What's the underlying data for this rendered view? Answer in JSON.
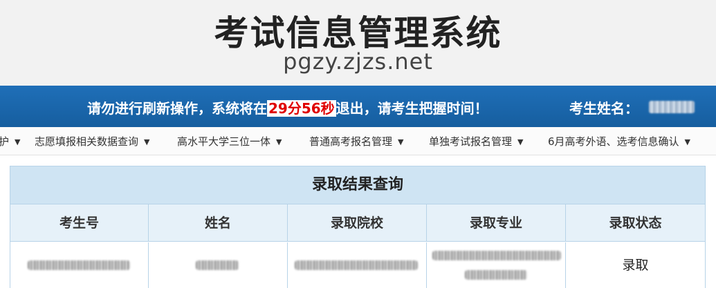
{
  "header": {
    "title": "考试信息管理系统",
    "url": "pgzy.zjzs.net"
  },
  "notice": {
    "prefix": "请勿进行刷新操作，系统将在",
    "countdown": "29分56秒",
    "suffix": "退出，请考生把握时间！",
    "name_label": "考生姓名："
  },
  "nav": {
    "items": [
      {
        "label": "护"
      },
      {
        "label": "志愿填报相关数据查询"
      },
      {
        "label": "高水平大学三位一体"
      },
      {
        "label": "普通高考报名管理"
      },
      {
        "label": "单独考试报名管理"
      },
      {
        "label": "6月高考外语、选考信息确认"
      }
    ]
  },
  "result": {
    "title": "录取结果查询",
    "columns": [
      "考生号",
      "姓名",
      "录取院校",
      "录取专业",
      "录取状态"
    ],
    "row": {
      "status": "录取"
    }
  },
  "colors": {
    "notice_bar": "#1f6fb8",
    "countdown_text": "#e00000",
    "table_title_bg": "#cfe4f3",
    "table_header_bg": "#e6f1f9",
    "table_border": "#b7d3e8"
  }
}
